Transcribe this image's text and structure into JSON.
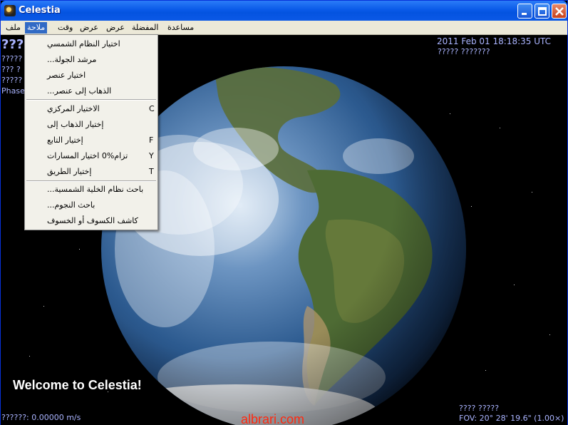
{
  "window": {
    "title": "Celestia"
  },
  "menubar": {
    "items": [
      "ملف",
      "ملاحة",
      "وقت",
      "عرض",
      "عرض",
      "المفضلة",
      "مساعدة"
    ]
  },
  "hud": {
    "datetime": "2011 Feb 01 18:18:35 UTC",
    "time_rate": "????? ???????",
    "object_name": "???",
    "info_lines": [
      "?????",
      "??? ?",
      "?????",
      "Phase"
    ],
    "speed": "??????: 0.00000 m/s",
    "target": "???? ?????",
    "fov": "FOV: 20° 28' 19.6\" (1.00×)",
    "welcome": "Welcome to Celestia!"
  },
  "watermark": "albrari.com",
  "dropdown": {
    "items": [
      {
        "label": "اختيار النظام الشمسي",
        "key": ""
      },
      {
        "label": "مرشد الجولة...",
        "key": ""
      },
      {
        "label": "اختيار عنصر",
        "key": ""
      },
      {
        "label": "الذهاب إلى عنصر...",
        "key": ""
      },
      {
        "label": "الاختيار المركزي",
        "key": "C"
      },
      {
        "label": "إختيار الذهاب إلى",
        "key": ""
      },
      {
        "label": "إختيار التابع",
        "key": "F"
      },
      {
        "label": "تزام%0 اختيار المسارات",
        "key": "Y"
      },
      {
        "label": "إختيار الطريق",
        "key": "T"
      },
      {
        "label": "باحث نظام الخلية الشمسية...",
        "key": ""
      },
      {
        "label": "باحث النجوم...",
        "key": ""
      },
      {
        "label": "كاشف الكسوف أو الخسوف",
        "key": ""
      }
    ]
  },
  "colors": {
    "titlebar": "#0a5ae8",
    "menu_highlight": "#316ac5",
    "hud_text": "#aab4ff",
    "watermark": "#ff2a10"
  }
}
